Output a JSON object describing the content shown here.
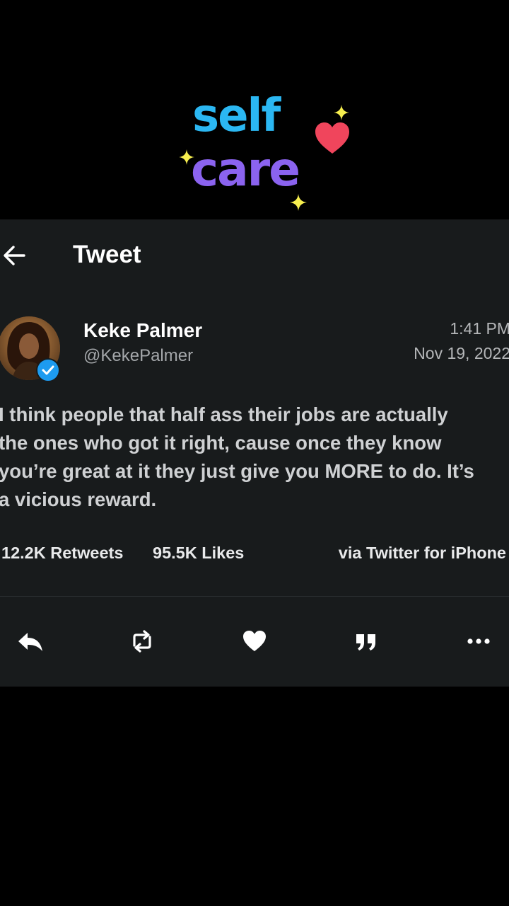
{
  "logo": {
    "word1": "self",
    "word2": "care"
  },
  "header": {
    "title": "Tweet",
    "back_icon": "arrow-left-icon"
  },
  "tweet": {
    "author_name": "Keke Palmer",
    "handle": "@KekePalmer",
    "time": "1:41 PM",
    "date": "Nov 19, 2022",
    "verified": true,
    "text_lines": [
      "I think people that half ass their jobs are actually",
      "the ones who got it right, cause once they know",
      "you’re great at it they just give you MORE to do. It’s",
      "a vicious reward."
    ],
    "retweets": "12.2K Retweets",
    "likes": "95.5K Likes",
    "source": "via Twitter for iPhone"
  },
  "actions": [
    "reply-icon",
    "retweet-icon",
    "heart-icon",
    "quote-icon",
    "more-icon"
  ],
  "colors": {
    "background": "#000000",
    "card": "#181b1c",
    "verified": "#1d9bf0",
    "logo_blue": "#2bb7f2",
    "logo_purple": "#8b63ef",
    "heart": "#f0455c",
    "sparkle": "#f6ee4f"
  }
}
